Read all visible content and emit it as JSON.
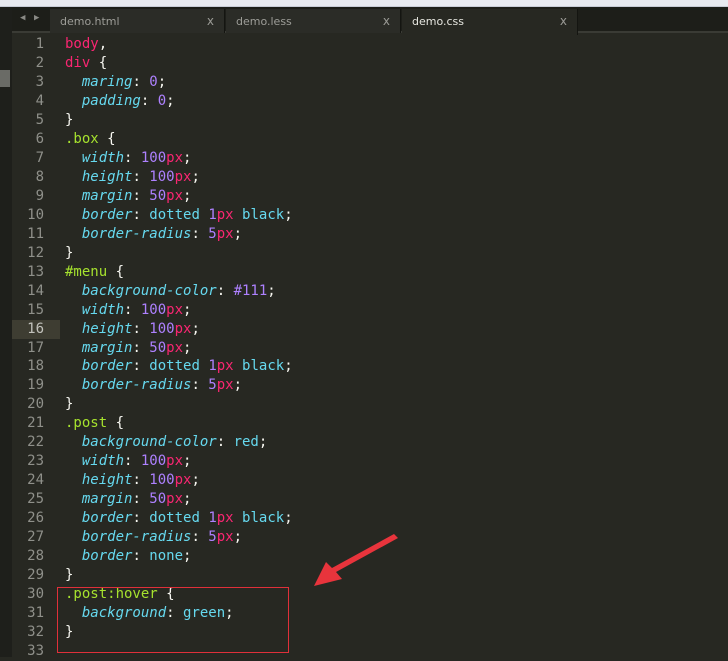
{
  "tabs": [
    {
      "label": "demo.html",
      "close": "x"
    },
    {
      "label": "demo.less",
      "close": "x"
    },
    {
      "label": "demo.css",
      "close": "x",
      "active": true
    }
  ],
  "nav": {
    "back": "◀",
    "forward": "▶"
  },
  "current_line": 16,
  "annotation_color": "#e0303a",
  "lines": [
    [
      [
        "body",
        "tag"
      ],
      [
        ",",
        "punc"
      ]
    ],
    [
      [
        "div",
        "tag"
      ],
      [
        " {",
        "punc"
      ]
    ],
    [
      [
        "  ",
        "punc"
      ],
      [
        "maring",
        "prop"
      ],
      [
        ": ",
        "punc"
      ],
      [
        "0",
        "num"
      ],
      [
        ";",
        "punc"
      ]
    ],
    [
      [
        "  ",
        "punc"
      ],
      [
        "padding",
        "prop"
      ],
      [
        ": ",
        "punc"
      ],
      [
        "0",
        "num"
      ],
      [
        ";",
        "punc"
      ]
    ],
    [
      [
        "}",
        "punc"
      ]
    ],
    [
      [
        ".box",
        "sel"
      ],
      [
        " {",
        "punc"
      ]
    ],
    [
      [
        "  ",
        "punc"
      ],
      [
        "width",
        "prop"
      ],
      [
        ": ",
        "punc"
      ],
      [
        "100",
        "num"
      ],
      [
        "px",
        "unit"
      ],
      [
        ";",
        "punc"
      ]
    ],
    [
      [
        "  ",
        "punc"
      ],
      [
        "height",
        "prop"
      ],
      [
        ": ",
        "punc"
      ],
      [
        "100",
        "num"
      ],
      [
        "px",
        "unit"
      ],
      [
        ";",
        "punc"
      ]
    ],
    [
      [
        "  ",
        "punc"
      ],
      [
        "margin",
        "prop"
      ],
      [
        ": ",
        "punc"
      ],
      [
        "50",
        "num"
      ],
      [
        "px",
        "unit"
      ],
      [
        ";",
        "punc"
      ]
    ],
    [
      [
        "  ",
        "punc"
      ],
      [
        "border",
        "prop"
      ],
      [
        ": ",
        "punc"
      ],
      [
        "dotted",
        "val"
      ],
      [
        " ",
        "punc"
      ],
      [
        "1",
        "num"
      ],
      [
        "px",
        "unit"
      ],
      [
        " ",
        "punc"
      ],
      [
        "black",
        "val"
      ],
      [
        ";",
        "punc"
      ]
    ],
    [
      [
        "  ",
        "punc"
      ],
      [
        "border-radius",
        "prop"
      ],
      [
        ": ",
        "punc"
      ],
      [
        "5",
        "num"
      ],
      [
        "px",
        "unit"
      ],
      [
        ";",
        "punc"
      ]
    ],
    [
      [
        "}",
        "punc"
      ]
    ],
    [
      [
        "#menu",
        "sel"
      ],
      [
        " {",
        "punc"
      ]
    ],
    [
      [
        "  ",
        "punc"
      ],
      [
        "background-color",
        "prop"
      ],
      [
        ": ",
        "punc"
      ],
      [
        "#111",
        "num"
      ],
      [
        ";",
        "punc"
      ]
    ],
    [
      [
        "  ",
        "punc"
      ],
      [
        "width",
        "prop"
      ],
      [
        ": ",
        "punc"
      ],
      [
        "100",
        "num"
      ],
      [
        "px",
        "unit"
      ],
      [
        ";",
        "punc"
      ]
    ],
    [
      [
        "  ",
        "punc"
      ],
      [
        "height",
        "prop"
      ],
      [
        ": ",
        "punc"
      ],
      [
        "100",
        "num"
      ],
      [
        "px",
        "unit"
      ],
      [
        ";",
        "punc"
      ]
    ],
    [
      [
        "  ",
        "punc"
      ],
      [
        "margin",
        "prop"
      ],
      [
        ": ",
        "punc"
      ],
      [
        "50",
        "num"
      ],
      [
        "px",
        "unit"
      ],
      [
        ";",
        "punc"
      ]
    ],
    [
      [
        "  ",
        "punc"
      ],
      [
        "border",
        "prop"
      ],
      [
        ": ",
        "punc"
      ],
      [
        "dotted",
        "val"
      ],
      [
        " ",
        "punc"
      ],
      [
        "1",
        "num"
      ],
      [
        "px",
        "unit"
      ],
      [
        " ",
        "punc"
      ],
      [
        "black",
        "val"
      ],
      [
        ";",
        "punc"
      ]
    ],
    [
      [
        "  ",
        "punc"
      ],
      [
        "border-radius",
        "prop"
      ],
      [
        ": ",
        "punc"
      ],
      [
        "5",
        "num"
      ],
      [
        "px",
        "unit"
      ],
      [
        ";",
        "punc"
      ]
    ],
    [
      [
        "}",
        "punc"
      ]
    ],
    [
      [
        ".post",
        "sel"
      ],
      [
        " {",
        "punc"
      ]
    ],
    [
      [
        "  ",
        "punc"
      ],
      [
        "background-color",
        "prop"
      ],
      [
        ": ",
        "punc"
      ],
      [
        "red",
        "val"
      ],
      [
        ";",
        "punc"
      ]
    ],
    [
      [
        "  ",
        "punc"
      ],
      [
        "width",
        "prop"
      ],
      [
        ": ",
        "punc"
      ],
      [
        "100",
        "num"
      ],
      [
        "px",
        "unit"
      ],
      [
        ";",
        "punc"
      ]
    ],
    [
      [
        "  ",
        "punc"
      ],
      [
        "height",
        "prop"
      ],
      [
        ": ",
        "punc"
      ],
      [
        "100",
        "num"
      ],
      [
        "px",
        "unit"
      ],
      [
        ";",
        "punc"
      ]
    ],
    [
      [
        "  ",
        "punc"
      ],
      [
        "margin",
        "prop"
      ],
      [
        ": ",
        "punc"
      ],
      [
        "50",
        "num"
      ],
      [
        "px",
        "unit"
      ],
      [
        ";",
        "punc"
      ]
    ],
    [
      [
        "  ",
        "punc"
      ],
      [
        "border",
        "prop"
      ],
      [
        ": ",
        "punc"
      ],
      [
        "dotted",
        "val"
      ],
      [
        " ",
        "punc"
      ],
      [
        "1",
        "num"
      ],
      [
        "px",
        "unit"
      ],
      [
        " ",
        "punc"
      ],
      [
        "black",
        "val"
      ],
      [
        ";",
        "punc"
      ]
    ],
    [
      [
        "  ",
        "punc"
      ],
      [
        "border-radius",
        "prop"
      ],
      [
        ": ",
        "punc"
      ],
      [
        "5",
        "num"
      ],
      [
        "px",
        "unit"
      ],
      [
        ";",
        "punc"
      ]
    ],
    [
      [
        "  ",
        "punc"
      ],
      [
        "border",
        "prop"
      ],
      [
        ": ",
        "punc"
      ],
      [
        "none",
        "val"
      ],
      [
        ";",
        "punc"
      ]
    ],
    [
      [
        "}",
        "punc"
      ]
    ],
    [
      [
        ".post:hover",
        "sel"
      ],
      [
        " {",
        "punc"
      ]
    ],
    [
      [
        "  ",
        "punc"
      ],
      [
        "background",
        "prop"
      ],
      [
        ": ",
        "punc"
      ],
      [
        "green",
        "val"
      ],
      [
        ";",
        "punc"
      ]
    ],
    [
      [
        "}",
        "punc"
      ]
    ],
    []
  ]
}
